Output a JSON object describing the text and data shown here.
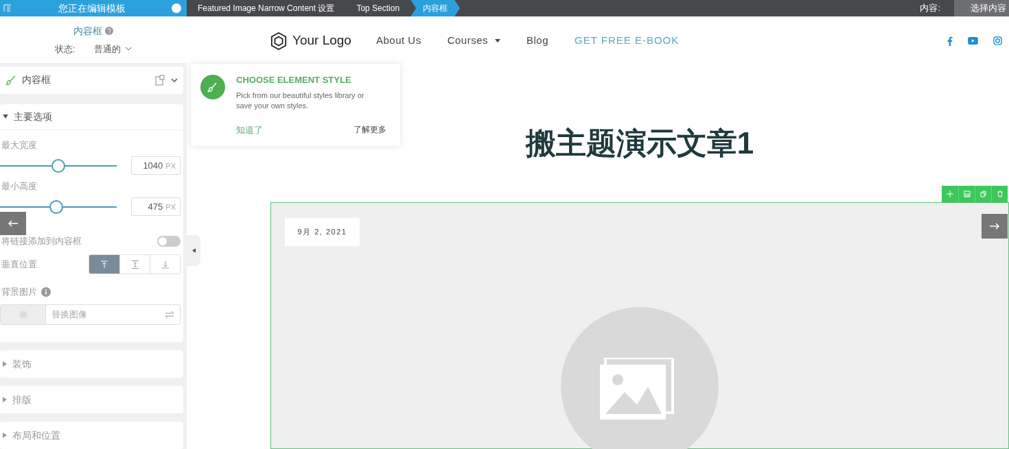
{
  "top_bar": {
    "editing_label": "您正在编辑模板",
    "breadcrumbs": [
      {
        "label": "Featured Image Narrow Content 设置",
        "selected": false
      },
      {
        "label": "Top Section",
        "selected": false
      },
      {
        "label": "内容框",
        "selected": true
      }
    ],
    "content_label": "内容:",
    "content_value": "选择内容"
  },
  "panel": {
    "title": "内容框",
    "state_label": "状态:",
    "state_value": "普通的",
    "element_name": "内容框",
    "main_section": {
      "title": "主要选项",
      "expanded": true,
      "controls": [
        {
          "kind": "slider",
          "label": "最大宽度",
          "level": 0.5,
          "value": "1040",
          "unit": "PX"
        },
        {
          "kind": "slider",
          "label": "最小高度",
          "level": 0.48,
          "value": "475",
          "unit": "PX"
        },
        {
          "kind": "toggle",
          "label": "将链接添加到内容框",
          "on": false
        },
        {
          "kind": "segmented",
          "label": "垂直位置",
          "options": [
            {
              "selected": true
            },
            {
              "selected": false
            },
            {
              "selected": false
            }
          ]
        },
        {
          "kind": "image",
          "label": "背景图片",
          "placeholder": "替换图像"
        }
      ]
    },
    "sections": [
      {
        "title": "装饰",
        "expanded": false
      },
      {
        "title": "排版",
        "expanded": false
      },
      {
        "title": "布局和位置",
        "expanded": false
      }
    ]
  },
  "popover": {
    "title": "CHOOSE ELEMENT STYLE",
    "body": "Pick from our beautiful styles library or save your own styles.",
    "confirm": "知道了",
    "learn_more": "了解更多"
  },
  "site": {
    "logo": "Your Logo",
    "nav": [
      {
        "label": "About Us",
        "kind": "link"
      },
      {
        "label": "Courses",
        "kind": "dropdown"
      },
      {
        "label": "Blog",
        "kind": "link"
      },
      {
        "label": "GET FREE E-BOOK",
        "kind": "cta"
      }
    ]
  },
  "article": {
    "title": "搬主题演示文章1",
    "date": "9月 2, 2021"
  }
}
